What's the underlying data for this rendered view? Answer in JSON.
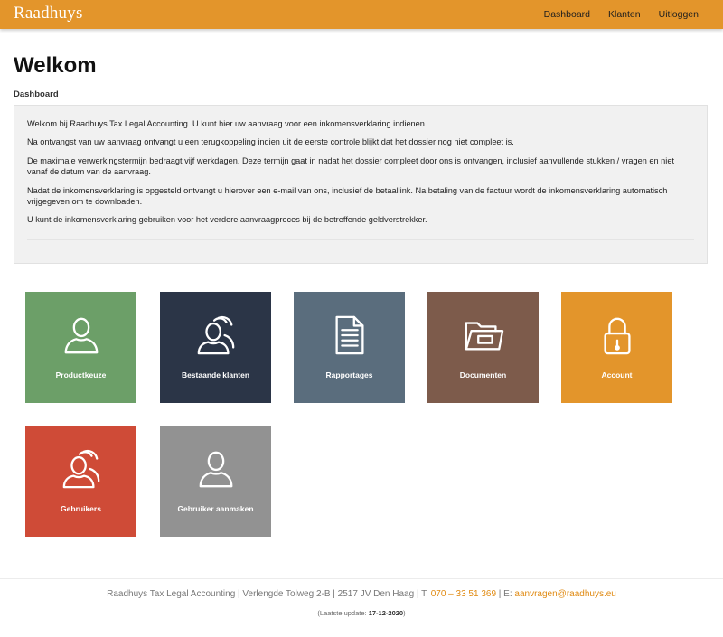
{
  "navbar": {
    "brand": "Raadhuys",
    "links": [
      "Dashboard",
      "Klanten",
      "Uitloggen"
    ],
    "color": "#e3952b"
  },
  "page": {
    "title": "Welkom",
    "section": "Dashboard"
  },
  "intro": {
    "paragraphs": [
      "Welkom bij Raadhuys Tax Legal Accounting. U kunt hier uw aanvraag voor een inkomensverklaring indienen.",
      "Na ontvangst van uw aanvraag ontvangt u een terugkoppeling indien uit de eerste controle blijkt dat het dossier nog niet compleet is.",
      "De maximale verwerkingstermijn bedraagt vijf werkdagen. Deze termijn gaat in nadat het dossier compleet door ons is ontvangen, inclusief aanvullende stukken / vragen en niet vanaf de datum van de aanvraag.",
      "Nadat de inkomensverklaring is opgesteld ontvangt u hierover een e-mail van ons, inclusief de betaallink. Na betaling van de factuur wordt de inkomensverklaring automatisch vrijgegeven om te downloaden.",
      "U kunt de inkomensverklaring gebruiken voor het verdere aanvraagproces bij de betreffende geldverstrekker."
    ]
  },
  "tiles": [
    {
      "label": "Productkeuze",
      "icon": "user-icon",
      "color": "#6c9f68"
    },
    {
      "label": "Bestaande klanten",
      "icon": "users-icon",
      "color": "#2b3547"
    },
    {
      "label": "Rapportages",
      "icon": "document-icon",
      "color": "#5a6d7d"
    },
    {
      "label": "Documenten",
      "icon": "folder-icon",
      "color": "#7d5b4b"
    },
    {
      "label": "Account",
      "icon": "lock-icon",
      "color": "#e3952b"
    },
    {
      "label": "Gebruikers",
      "icon": "users-icon",
      "color": "#cf4b37"
    },
    {
      "label": "Gebruiker aanmaken",
      "icon": "user-icon",
      "color": "#929292"
    }
  ],
  "footer": {
    "address": "Raadhuys Tax Legal Accounting | Verlengde Tolweg 2-B | 2517 JV Den Haag | T:",
    "phone": "070 – 33 51 369",
    "email_prefix": "| E:",
    "email": "aanvragen@raadhuys.eu",
    "update_prefix": "(Laatste update:",
    "update_date": "17-12-2020",
    "update_suffix": ")",
    "link_color": "#e08a12"
  }
}
